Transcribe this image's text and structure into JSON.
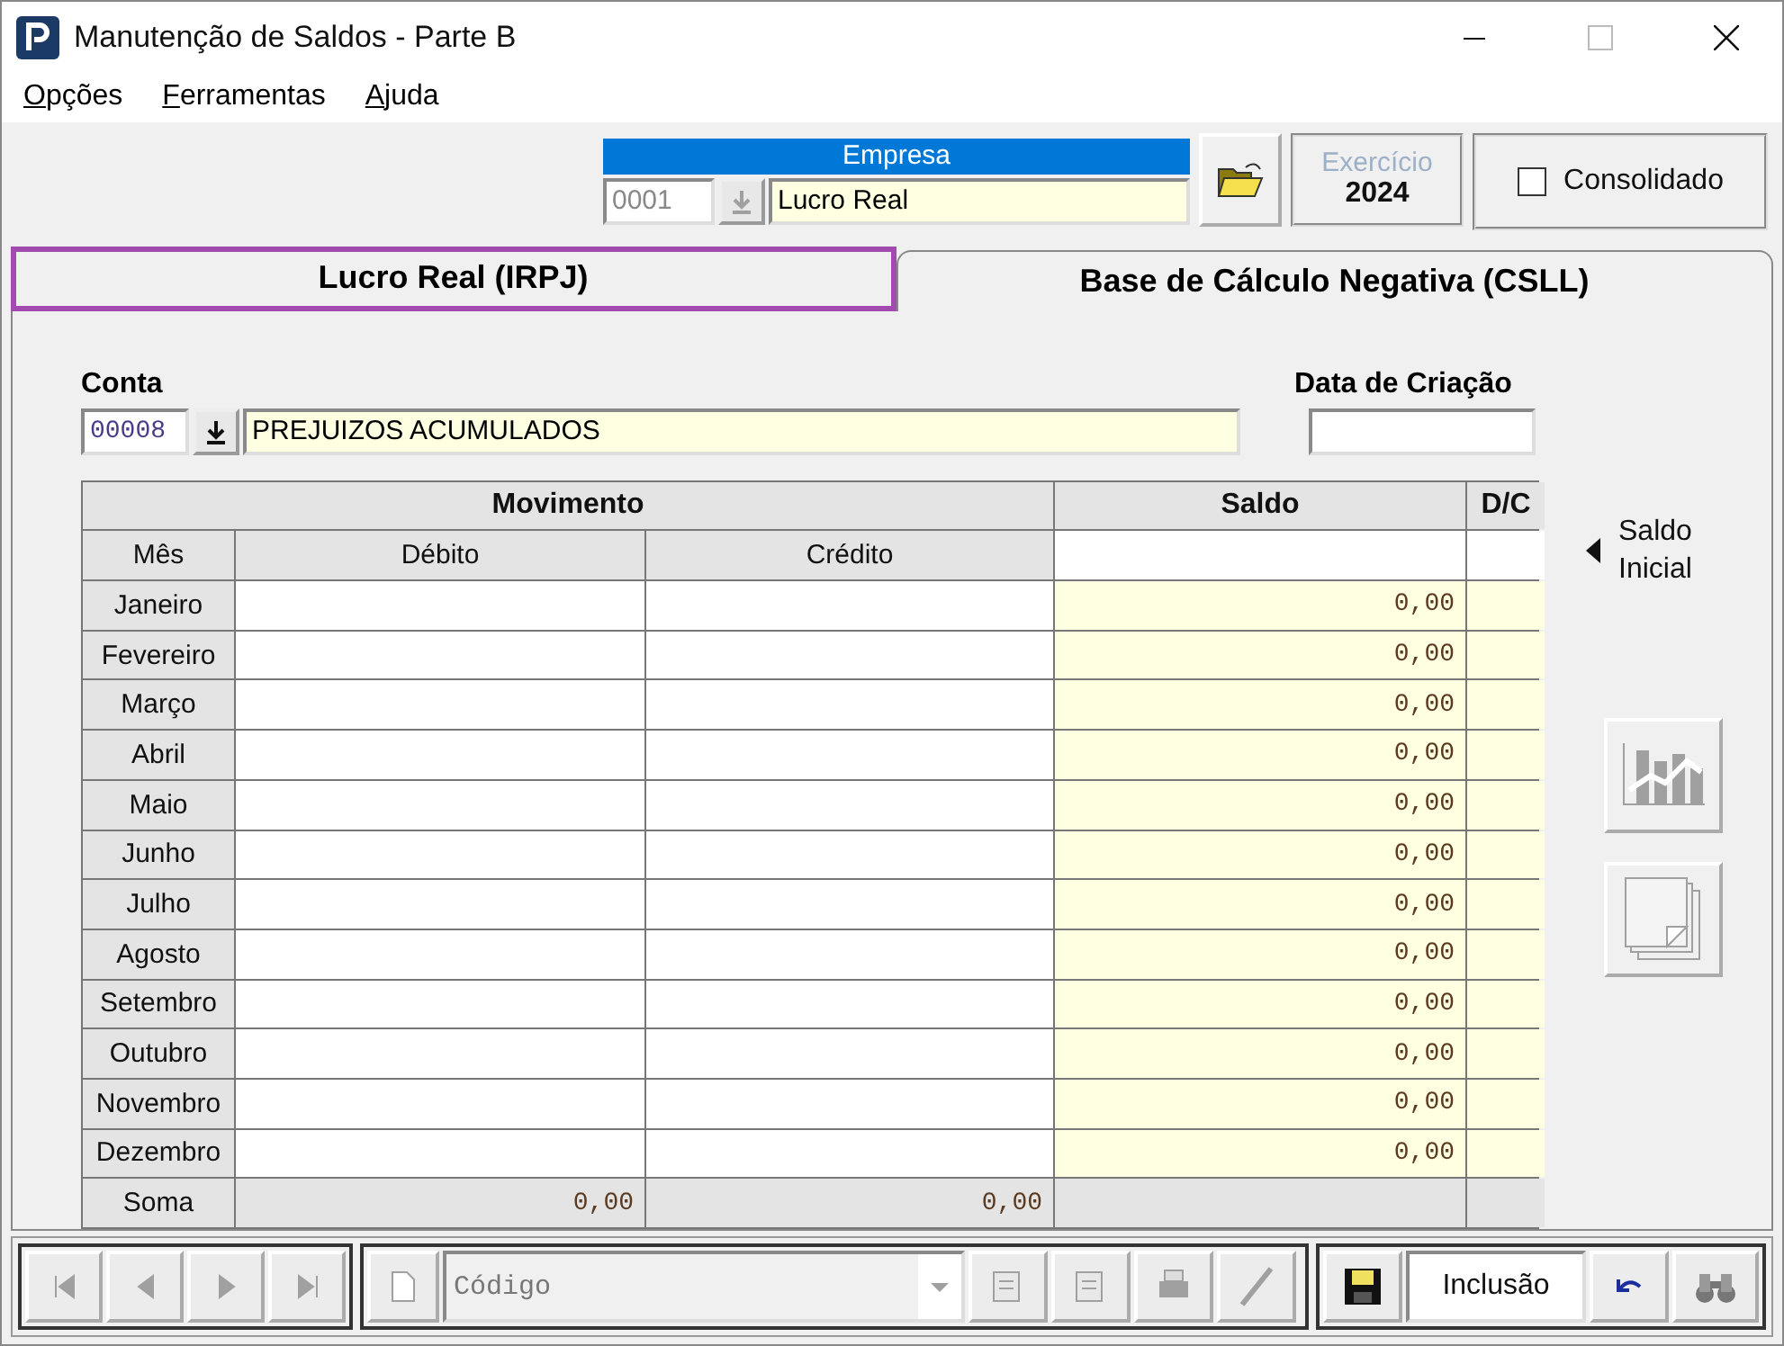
{
  "window": {
    "title": "Manutenção de Saldos - Parte B"
  },
  "menu": [
    {
      "label": "Opções"
    },
    {
      "label": "Ferramentas"
    },
    {
      "label": "Ajuda"
    }
  ],
  "empresa": {
    "label": "Empresa",
    "code": "0001",
    "name": "Lucro Real"
  },
  "exercicio": {
    "label": "Exercício",
    "year": "2024"
  },
  "consolidado": {
    "label": "Consolidado",
    "checked": false
  },
  "tabs": [
    {
      "label": "Lucro Real (IRPJ)",
      "selected": true
    },
    {
      "label": "Base de Cálculo Negativa (CSLL)",
      "selected": false
    }
  ],
  "conta": {
    "label": "Conta",
    "code": "00008",
    "name": "PREJUIZOS ACUMULADOS"
  },
  "data_criacao": {
    "label": "Data de Criação"
  },
  "table": {
    "group_headers": [
      "Movimento",
      "Saldo",
      "D/C"
    ],
    "columns": [
      "Mês",
      "Débito",
      "Crédito"
    ],
    "rows": [
      {
        "month": "Janeiro",
        "saldo": "0,00"
      },
      {
        "month": "Fevereiro",
        "saldo": "0,00"
      },
      {
        "month": "Março",
        "saldo": "0,00"
      },
      {
        "month": "Abril",
        "saldo": "0,00"
      },
      {
        "month": "Maio",
        "saldo": "0,00"
      },
      {
        "month": "Junho",
        "saldo": "0,00"
      },
      {
        "month": "Julho",
        "saldo": "0,00"
      },
      {
        "month": "Agosto",
        "saldo": "0,00"
      },
      {
        "month": "Setembro",
        "saldo": "0,00"
      },
      {
        "month": "Outubro",
        "saldo": "0,00"
      },
      {
        "month": "Novembro",
        "saldo": "0,00"
      },
      {
        "month": "Dezembro",
        "saldo": "0,00"
      }
    ],
    "total": {
      "label": "Soma",
      "debito": "0,00",
      "credito": "0,00"
    }
  },
  "saldo_inicial": "Saldo Inicial",
  "toolbar": {
    "code_placeholder": "Código",
    "mode": "Inclusão"
  }
}
